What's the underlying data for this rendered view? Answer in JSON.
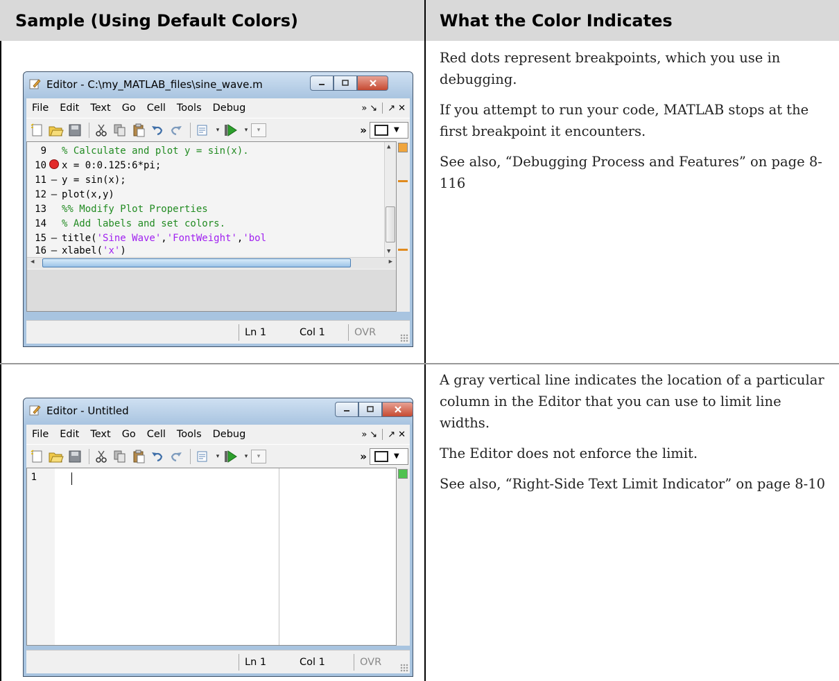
{
  "table": {
    "header_left": "Sample (Using Default Colors)",
    "header_right": "What the Color Indicates"
  },
  "rows": [
    {
      "paragraphs": [
        "Red dots represent breakpoints, which you use in debugging.",
        "If you attempt to run your code, MATLAB stops at the first breakpoint it encounters.",
        "See also, “Debugging Process and Features” on page 8-116"
      ],
      "editor": {
        "title": "Editor - C:\\my_MATLAB_files\\sine_wave.m",
        "menu": [
          "File",
          "Edit",
          "Text",
          "Go",
          "Cell",
          "Tools",
          "Debug"
        ],
        "lines": [
          {
            "num": "9",
            "mark": "",
            "code": "% Calculate and plot y = sin(x)."
          },
          {
            "num": "10",
            "mark": "breakpoint",
            "code": "x = 0:0.125:6*pi;"
          },
          {
            "num": "11",
            "mark": "–",
            "code": "y = sin(x);"
          },
          {
            "num": "12",
            "mark": "–",
            "code": "plot(x,y)"
          },
          {
            "num": "13",
            "mark": "",
            "code": "%% Modify Plot Properties"
          },
          {
            "num": "14",
            "mark": "",
            "code": "% Add labels and set colors."
          },
          {
            "num": "15",
            "mark": "–",
            "code_a": "title(",
            "code_b": "'Sine Wave'",
            "code_c": ",",
            "code_d": "'FontWeight'",
            "code_e": ",",
            "code_f": "'bol"
          },
          {
            "num": "16",
            "mark": "–",
            "code_a": "xlabel(",
            "code_b": "'x'",
            "code_c": ")"
          }
        ],
        "status": {
          "ln": "Ln  1",
          "col": "Col  1",
          "ovr": "OVR"
        }
      }
    },
    {
      "paragraphs": [
        "A gray vertical line indicates the location of a particular column in the Editor that you can use to limit line widths.",
        "The Editor does not enforce the limit.",
        "See also, “Right-Side Text Limit Indicator” on page 8-10"
      ],
      "editor": {
        "title": "Editor - Untitled",
        "menu": [
          "File",
          "Edit",
          "Text",
          "Go",
          "Cell",
          "Tools",
          "Debug"
        ],
        "lines": [
          {
            "num": "1",
            "mark": "",
            "code": ""
          }
        ],
        "status": {
          "ln": "Ln  1",
          "col": "Col  1",
          "ovr": "OVR"
        }
      }
    }
  ],
  "colors": {
    "header_bg": "#d9d9d9",
    "breakpoint": "#e32b2b",
    "comment": "#228b22",
    "string": "#a020f0",
    "warning_marker": "#e08a1e",
    "ok_marker": "#4fc24f"
  }
}
